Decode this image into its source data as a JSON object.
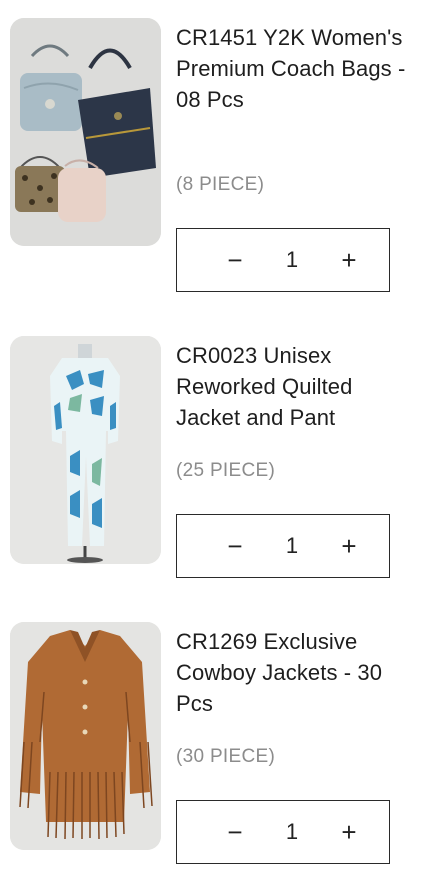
{
  "products": [
    {
      "title": "CR1451 Y2K Women's Premium Coach Bags  - 08 Pcs",
      "pieces": "(8  PIECE)",
      "quantity": "1",
      "minus": "−",
      "plus": "+",
      "image_icon": "coach-bags-image"
    },
    {
      "title": "CR0023 Unisex Reworked Quilted Jacket and Pant",
      "pieces": "(25  PIECE)",
      "quantity": "1",
      "minus": "−",
      "plus": "+",
      "image_icon": "quilted-jacket-pant-image"
    },
    {
      "title": "CR1269 Exclusive Cowboy Jackets - 30 Pcs",
      "pieces": "(30  PIECE)",
      "quantity": "1",
      "minus": "−",
      "plus": "+",
      "image_icon": "cowboy-jacket-image"
    }
  ],
  "colors": {
    "border": "#2a2a2a",
    "muted_text": "#8c8c8c",
    "thumb_bg": "#e3e3e1"
  }
}
